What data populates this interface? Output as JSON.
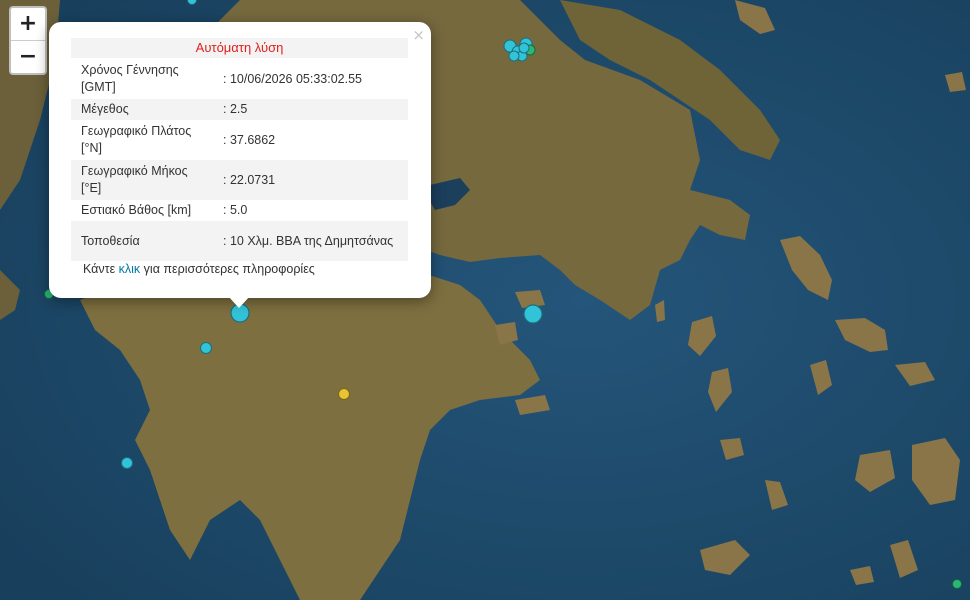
{
  "zoom": {
    "in_label": "+",
    "out_label": "−"
  },
  "popup": {
    "close_label": "×",
    "title": "Αυτόματη λύση",
    "title_color": "#e0211d",
    "rows": [
      {
        "label": "Χρόνος Γέννησης [GMT]",
        "value": ": 10/06/2026 05:33:02.55"
      },
      {
        "label": "Μέγεθος",
        "value": ": 2.5"
      },
      {
        "label": "Γεωγραφικό Πλάτος [°N]",
        "value": ": 37.6862"
      },
      {
        "label": "Γεωγραφικό Μήκος [°E]",
        "value": ": 22.0731"
      },
      {
        "label": "Εστιακό Βάθος [km]",
        "value": ": 5.0"
      },
      {
        "label": "Τοποθεσία",
        "value": ": 10 Χλμ. ΒΒΑ της Δημητσάνας"
      }
    ],
    "more_before": "Κάντε ",
    "more_link": "κλικ",
    "more_after": " για περισσότερες πληροφορίες"
  },
  "colors": {
    "sea": "#1f4f6e",
    "land": "#7a6c3f",
    "marker_cyan": "#33c3d8",
    "marker_yellow": "#e6c435",
    "marker_green": "#2bb673"
  }
}
